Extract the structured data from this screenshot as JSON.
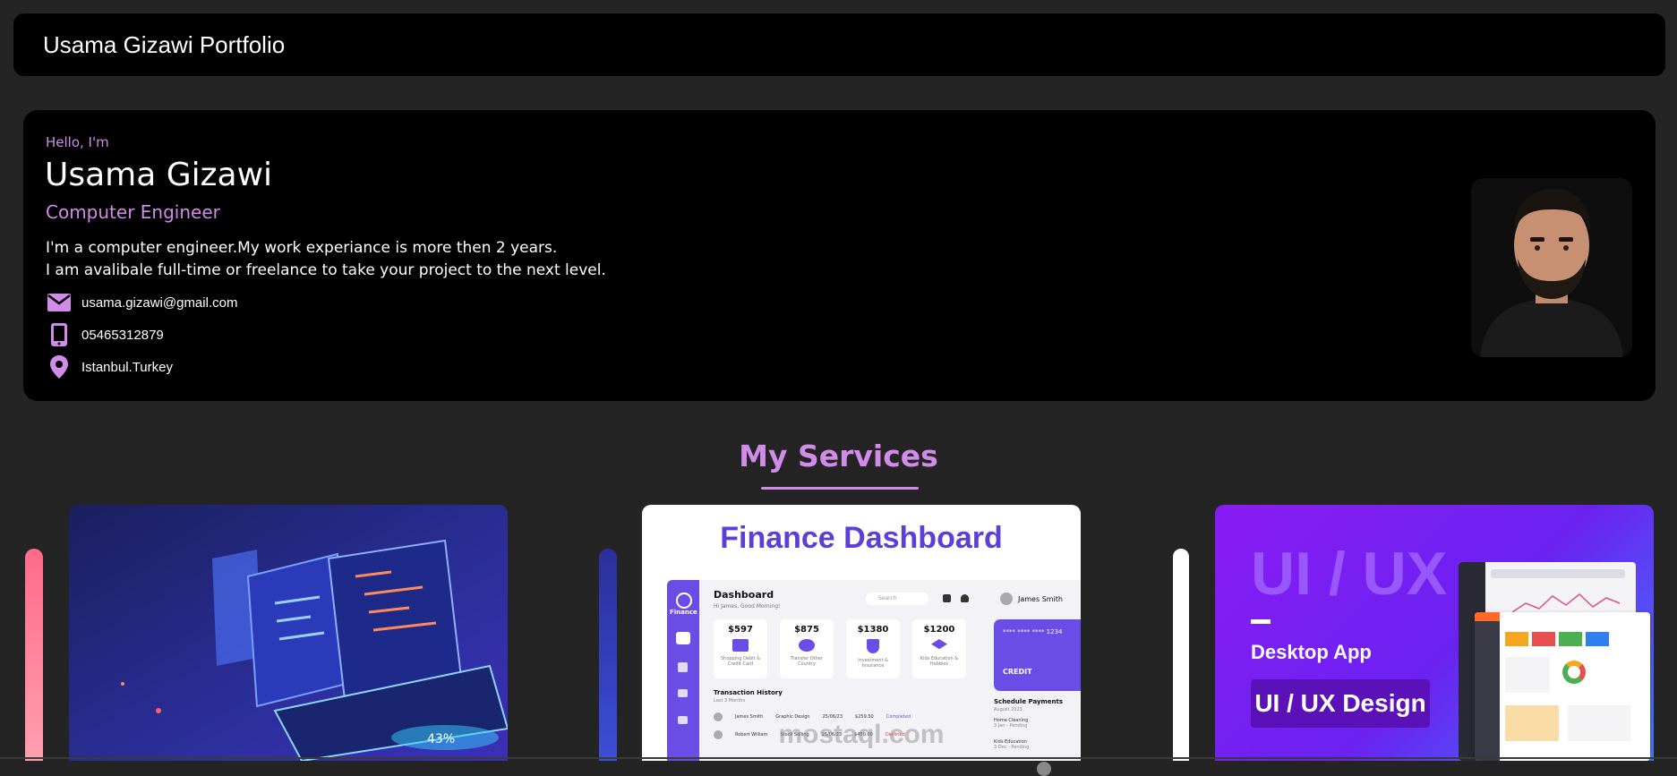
{
  "header": {
    "title": "Usama Gizawi Portfolio"
  },
  "hero": {
    "greeting": "Hello, I'm",
    "name": "Usama Gizawi",
    "role": "Computer Engineer",
    "desc_line1": "I'm a computer engineer.My work experiance is more then 2 years.",
    "desc_line2": "I am avalibale full-time or freelance to take your project to the next level.",
    "email": "usama.gizawi@gmail.com",
    "phone": "05465312879",
    "location": "Istanbul.Turkey",
    "icons": [
      "mail-icon",
      "phone-icon",
      "location-pin-icon"
    ]
  },
  "services": {
    "title": "My Services",
    "cards": [
      {
        "label": ""
      },
      {
        "heading": "Finance Dashboard",
        "app_name": "Finance",
        "dash_title": "Dashboard",
        "dash_sub": "Hi James, Good Morning!",
        "search": "Search",
        "user": "James Smith",
        "stats": [
          "$597",
          "$875",
          "$1380",
          "$1200"
        ],
        "stat_labels": [
          "Shopping Debit & Credit Card",
          "Transfer Other Country",
          "Investment & Insurance",
          "Kids Education & Hobbies"
        ],
        "card_number": "**** **** **** 1234",
        "card_type": "CREDIT",
        "section1": "Transaction History",
        "section1_sub": "Last 3 Months",
        "section2": "Schedule Payments",
        "section2_sub": "August 2023",
        "rows": [
          {
            "name": "James Smith",
            "cat": "Graphic Design",
            "date": "25/06/23",
            "amount": "$259.50",
            "status": "Completed"
          },
          {
            "name": "Robert William",
            "cat": "Stock Selling",
            "date": "25/06/23",
            "amount": "$450.00",
            "status": "Declined"
          }
        ],
        "payments": [
          {
            "name": "Home Cleaning",
            "sub": "3 Jan - Pending"
          },
          {
            "name": "Kids Education",
            "sub": "3 Dec - Pending"
          }
        ],
        "watermark": "mostaql.com"
      },
      {
        "big": "UI / UX",
        "sub": "Desktop App",
        "badge": "UI / UX Design"
      }
    ]
  },
  "colors": {
    "accent": "#d18be8",
    "background": "#242424",
    "panel": "#000000"
  }
}
